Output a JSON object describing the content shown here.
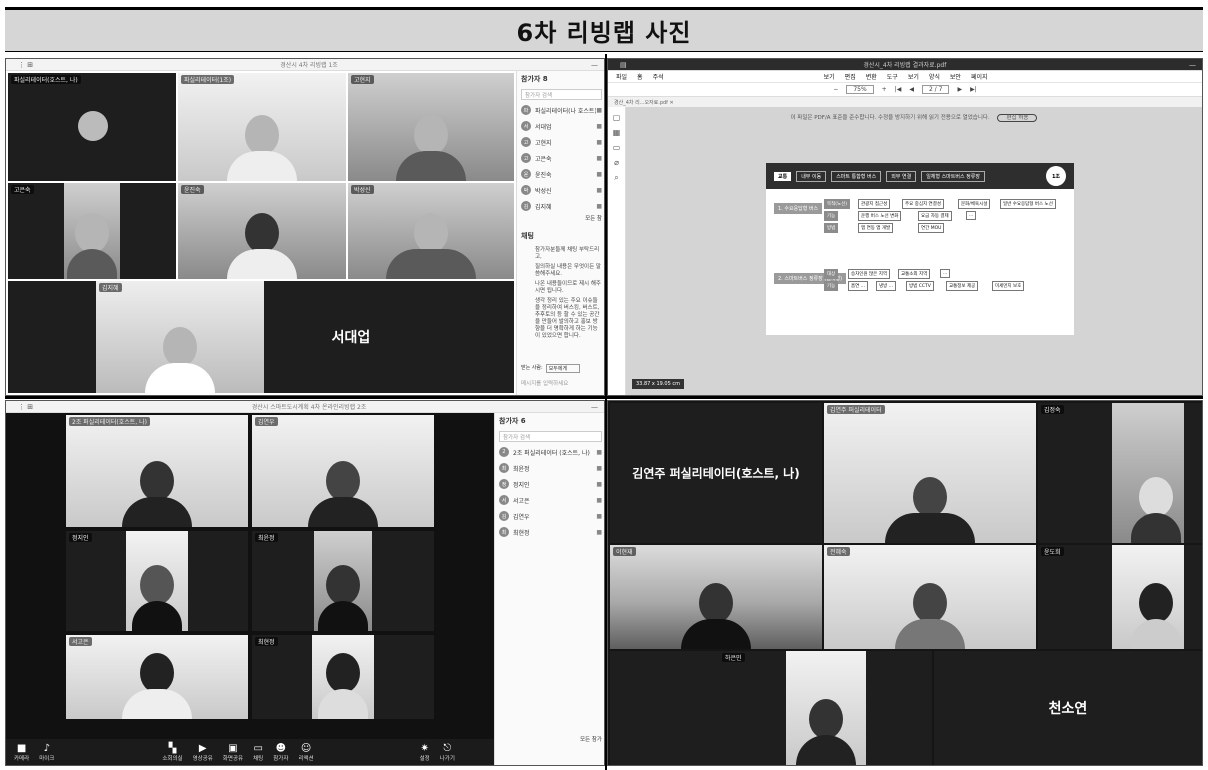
{
  "page_title": "6차 리빙랩 사진",
  "q1": {
    "window_title": "경산시 4차 리빙랩 1조",
    "tiles": [
      {
        "name": "파실리테이터(호스트, 나)"
      },
      {
        "name": "파실리테이터(1조)"
      },
      {
        "name": "고현지"
      },
      {
        "name": "고은숙"
      },
      {
        "name": "윤진숙"
      },
      {
        "name": "박성신"
      },
      {
        "name": "김지혜"
      },
      {
        "name": "서대업"
      }
    ],
    "big_name": "서대업",
    "participants_header": "참가자 8",
    "search_placeholder": "참가자 검색",
    "participants": [
      {
        "initial": "파",
        "name": "파실리테이터(나 호스트)"
      },
      {
        "initial": "서",
        "name": "서대업"
      },
      {
        "initial": "고",
        "name": "고현지"
      },
      {
        "initial": "고",
        "name": "고은숙"
      },
      {
        "initial": "윤",
        "name": "윤진숙"
      },
      {
        "initial": "박",
        "name": "박성신"
      },
      {
        "initial": "김",
        "name": "김지혜"
      }
    ],
    "all_label": "모든 참",
    "chat_header": "채팅",
    "chat_messages": [
      "참가자분들께 채팅 부탁드리고,",
      "질의하실 내용은 무엇이든 말씀해주세요.",
      "나온 내용들이므로 제시 해주시면 됩니다.",
      "생각 정리 있는 주요 이슈들을 정리하여 버스킹, 버스트, 추후토의 등 할 수 있는 공간을 만들어 발의하고 홍보 방향을 더 명확하게 하는 기능이 있었으면 합니다."
    ],
    "recipient_label": "받는 사람:",
    "recipient_value": "모두에게",
    "message_placeholder": "메시지를 입력하세요"
  },
  "q2": {
    "window_title": "경산시_4차 리빙랩 결과자료.pdf",
    "menu": [
      "파일",
      "홈",
      "주석",
      "보기",
      "편집",
      "변환",
      "도구",
      "보기",
      "양식",
      "보안",
      "페이지"
    ],
    "zoom": "75%",
    "page_indicator": "2 / 7",
    "tab_label": "경산_4차 리...오자료.pdf",
    "notice": "이 파일은 PDF/A 표준을 준수합니다. 수정을 방지하기 위해 읽기 전용으로 열었습니다.",
    "notice_button": "편집 허용",
    "doc": {
      "tag": "교통",
      "head_labels": [
        "내부 이동",
        "스마트 통합형 버스",
        "외부 연결",
        "일체형 스마트버스 정류장"
      ],
      "group": "1조",
      "section1": "1. 수요응답형 버스",
      "section2": "2. 스마트버스 정류장 (일체형)",
      "row_labels_1": [
        "목적(노선)",
        "기능",
        "방법"
      ],
      "cells_1": [
        "관광지 접근성",
        "주요 중심지 연결성",
        "문화/체육시설",
        "일반 수요응답형 버스 노선",
        "운행 버스 노선 변화",
        "요금 자동 결제",
        "...",
        "앱 연동 앱 개발",
        "연간 MOU"
      ],
      "row_labels_2": [
        "대상",
        "기능"
      ],
      "cells_2": [
        "승차인원 많은 지역",
        "교통소외 지역",
        "...",
        "흡연 ...",
        "냉방 ...",
        "방범 CCTV",
        "교통정보 제공",
        "미세먼지 보호"
      ]
    },
    "page_size": "33.87 x 19.05 cm"
  },
  "q3": {
    "window_title": "경산시 스마트도시계획 4차 온라인리빙랩 2조",
    "tiles": [
      {
        "name": "2조 퍼실리테이터(호스트, 나)"
      },
      {
        "name": "김연우"
      },
      {
        "name": "정지인"
      },
      {
        "name": "최윤정"
      },
      {
        "name": "서고은"
      },
      {
        "name": "최현정"
      }
    ],
    "participants_header": "참가자 6",
    "search_placeholder": "참가자 검색",
    "participants": [
      {
        "initial": "2",
        "name": "2조 퍼실리테이터 (호스트, 나)"
      },
      {
        "initial": "최",
        "name": "최윤정"
      },
      {
        "initial": "정",
        "name": "정지인"
      },
      {
        "initial": "서",
        "name": "서고은"
      },
      {
        "initial": "김",
        "name": "김연우"
      },
      {
        "initial": "최",
        "name": "최현정"
      }
    ],
    "toolbar": {
      "camera": "카메라",
      "mic": "마이크",
      "mode": "소회의실",
      "share_video": "영상공유",
      "share_screen": "화면공유",
      "chat": "채팅",
      "participants": "참가자",
      "reaction": "리액션",
      "settings": "설정",
      "leave": "나가기"
    },
    "all_label": "모든 참가"
  },
  "q4": {
    "tiles": [
      {
        "name": "김연주 퍼실리테이터"
      },
      {
        "name": "김정숙"
      },
      {
        "name": "이현재"
      },
      {
        "name": "전혜숙"
      },
      {
        "name": "윤도희"
      },
      {
        "name": "하은민"
      }
    ],
    "host_label": "김연주 퍼실리테이터(호스트, 나)",
    "big_name": "천소연"
  }
}
